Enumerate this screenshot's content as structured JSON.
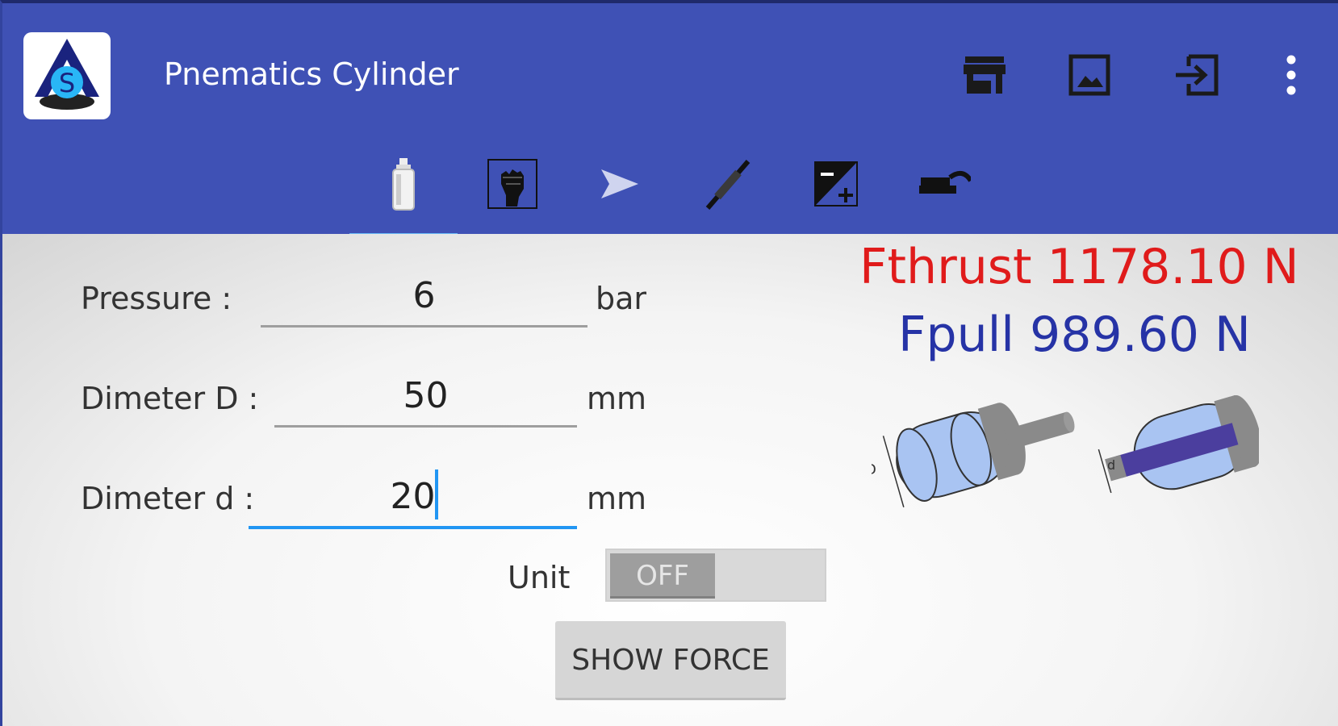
{
  "app": {
    "title": "Pnematics Cylinder",
    "logo_letter": "S"
  },
  "actions": [
    {
      "icon": "store-icon"
    },
    {
      "icon": "image-icon"
    },
    {
      "icon": "exit-icon"
    },
    {
      "icon": "more-vert-icon"
    }
  ],
  "tabs": [
    {
      "icon": "cylinder-icon",
      "selected": true
    },
    {
      "icon": "fist-icon",
      "selected": false
    },
    {
      "icon": "send-icon",
      "selected": false
    },
    {
      "icon": "pen-icon",
      "selected": false
    },
    {
      "icon": "plus-minus-icon",
      "selected": false
    },
    {
      "icon": "hammer-icon",
      "selected": false
    }
  ],
  "form": {
    "pressure_label": "Pressure :",
    "pressure_value": "6",
    "pressure_unit": "bar",
    "diameter_D_label": "Dimeter D :",
    "diameter_D_value": "50",
    "diameter_D_unit": "mm",
    "diameter_d_label": "Dimeter d :",
    "diameter_d_value": "20",
    "diameter_d_unit": "mm",
    "unit_label": "Unit",
    "unit_toggle_state": "OFF",
    "show_force_label": "SHOW FORCE"
  },
  "results": {
    "fthrust": "Fthrust 1178.10 N",
    "fpull": "Fpull 989.60 N"
  },
  "diagram": {
    "label_D": "D",
    "label_d": "d"
  },
  "colors": {
    "appbar": "#3f51b5",
    "accent": "#2196f3",
    "thrust": "#e01b1b",
    "pull": "#2633a6"
  }
}
